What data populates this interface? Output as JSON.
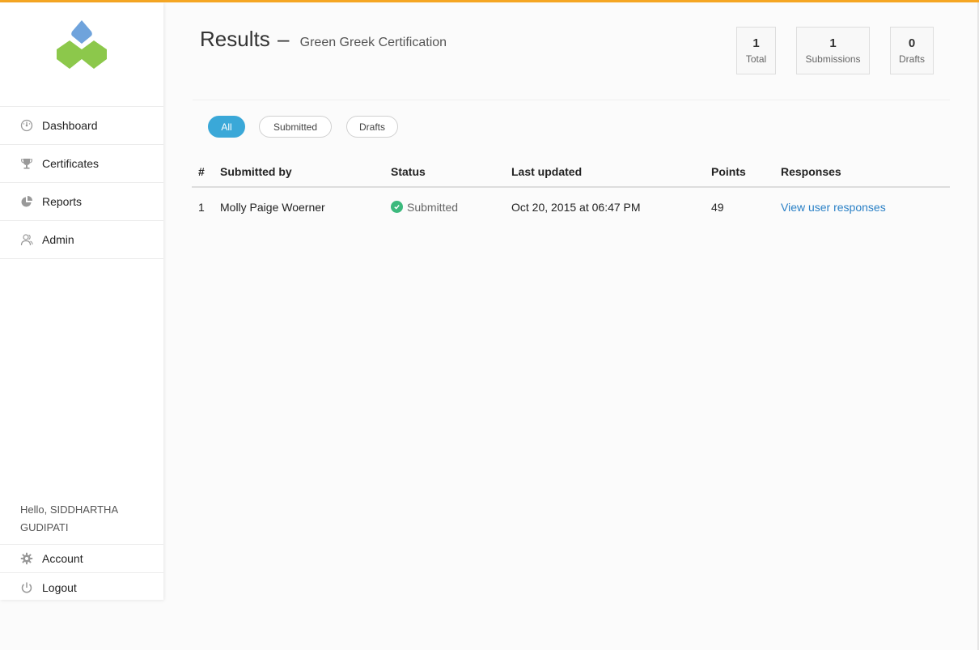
{
  "sidebar": {
    "nav": [
      {
        "label": "Dashboard",
        "icon": "dashboard-icon"
      },
      {
        "label": "Certificates",
        "icon": "trophy-icon"
      },
      {
        "label": "Reports",
        "icon": "pie-chart-icon"
      },
      {
        "label": "Admin",
        "icon": "users-icon"
      }
    ],
    "greeting": "Hello, SIDDHARTHA GUDIPATI",
    "account_label": "Account",
    "logout_label": "Logout"
  },
  "header": {
    "title": "Results",
    "dash": "–",
    "subtitle": "Green Greek Certification"
  },
  "stats": [
    {
      "value": "1",
      "label": "Total"
    },
    {
      "value": "1",
      "label": "Submissions"
    },
    {
      "value": "0",
      "label": "Drafts"
    }
  ],
  "filters": [
    {
      "label": "All",
      "active": true
    },
    {
      "label": "Submitted",
      "active": false
    },
    {
      "label": "Drafts",
      "active": false
    }
  ],
  "table": {
    "headers": [
      "#",
      "Submitted by",
      "Status",
      "Last updated",
      "Points",
      "Responses"
    ],
    "rows": [
      {
        "num": "1",
        "submitted_by": "Molly Paige Woerner",
        "status": "Submitted",
        "last_updated": "Oct 20, 2015 at 06:47 PM",
        "points": "49",
        "responses": "View user responses"
      }
    ]
  },
  "colors": {
    "accent_top": "#f5a623",
    "active_pill": "#3aa8d8",
    "link": "#2a80c6",
    "success": "#3cb97d",
    "logo_blue": "#6fa3dc",
    "logo_green": "#8cc84b"
  }
}
